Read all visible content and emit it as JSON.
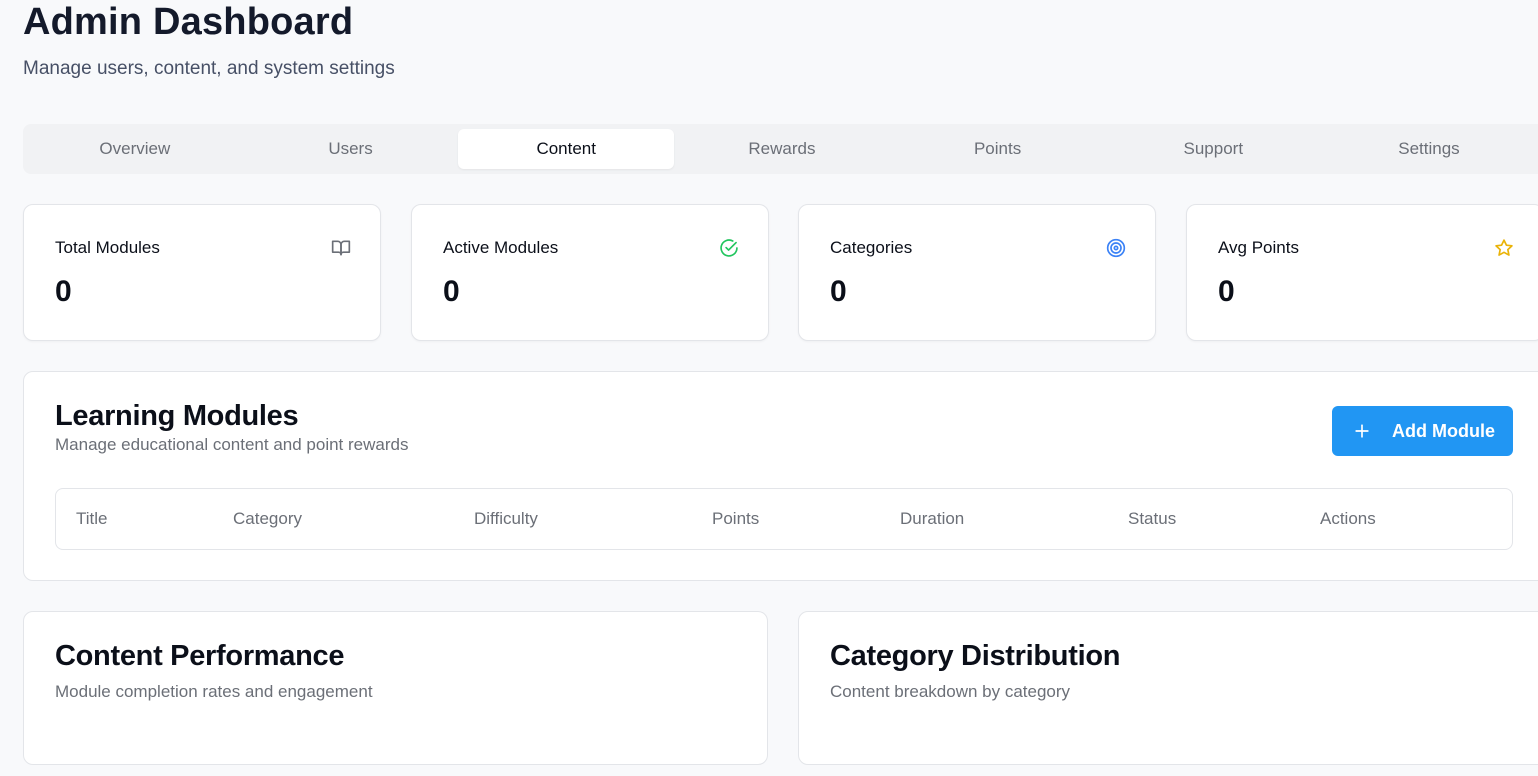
{
  "header": {
    "title": "Admin Dashboard",
    "subtitle": "Manage users, content, and system settings"
  },
  "tabs": [
    {
      "label": "Overview"
    },
    {
      "label": "Users"
    },
    {
      "label": "Content",
      "active": true
    },
    {
      "label": "Rewards"
    },
    {
      "label": "Points"
    },
    {
      "label": "Support"
    },
    {
      "label": "Settings"
    }
  ],
  "stats": [
    {
      "label": "Total Modules",
      "value": "0",
      "icon": "book-open-icon",
      "icon_color": "#6b6f77"
    },
    {
      "label": "Active Modules",
      "value": "0",
      "icon": "check-circle-icon",
      "icon_color": "#22c55e"
    },
    {
      "label": "Categories",
      "value": "0",
      "icon": "target-icon",
      "icon_color": "#3b82f6"
    },
    {
      "label": "Avg Points",
      "value": "0",
      "icon": "star-icon",
      "icon_color": "#eab308"
    }
  ],
  "modules": {
    "title": "Learning Modules",
    "description": "Manage educational content and point rewards",
    "add_button": "Add Module",
    "columns": [
      "Title",
      "Category",
      "Difficulty",
      "Points",
      "Duration",
      "Status",
      "Actions"
    ]
  },
  "performance": {
    "title": "Content Performance",
    "description": "Module completion rates and engagement"
  },
  "distribution": {
    "title": "Category Distribution",
    "description": "Content breakdown by category"
  },
  "colors": {
    "accent": "#2196f3",
    "background": "#f8f9fb"
  }
}
